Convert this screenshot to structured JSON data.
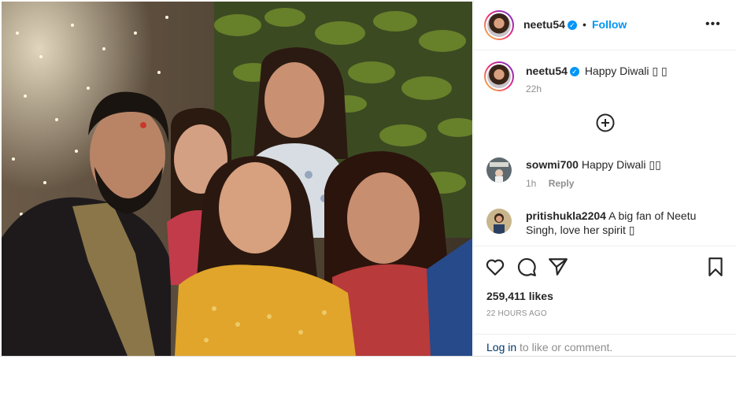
{
  "post": {
    "username": "neetu54",
    "verified_glyph": "✓",
    "separator": "•",
    "follow_label": "Follow",
    "more_label": "•••",
    "caption": {
      "username": "neetu54",
      "text": "Happy Diwali ▯ ▯",
      "time": "22h"
    },
    "comments": [
      {
        "username": "sowmi700",
        "text": "Happy Diwali ▯▯",
        "time": "1h",
        "reply_label": "Reply"
      },
      {
        "username": "pritishukla2204",
        "text": "A big fan of Neetu Singh, love her spirit ▯"
      }
    ],
    "likes": "259,411 likes",
    "posted_ago": "22 HOURS AGO",
    "login_link": "Log in",
    "login_suffix": " to like or comment."
  },
  "icons": {
    "load_more": "plus-circle-icon",
    "like": "heart-icon",
    "comment": "comment-icon",
    "share": "share-icon",
    "save": "bookmark-icon",
    "verified": "verified-badge-icon"
  },
  "colors": {
    "accent": "#0095f6",
    "text": "#262626",
    "muted": "#8e8e8e",
    "border": "#dbdbdb",
    "link": "#00376b"
  }
}
